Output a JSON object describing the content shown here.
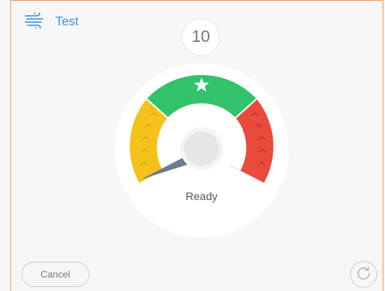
{
  "header": {
    "icon": "wind-icon",
    "label": "Test"
  },
  "counter": {
    "value": "10"
  },
  "gauge": {
    "status": "Ready",
    "zones": [
      {
        "name": "yellow",
        "color": "#f5c21b"
      },
      {
        "name": "green",
        "color": "#32c26b"
      },
      {
        "name": "red",
        "color": "#e84a3c"
      }
    ],
    "center_icon": "star-icon"
  },
  "footer": {
    "cancel_label": "Cancel",
    "reset_icon": "refresh-icon"
  }
}
